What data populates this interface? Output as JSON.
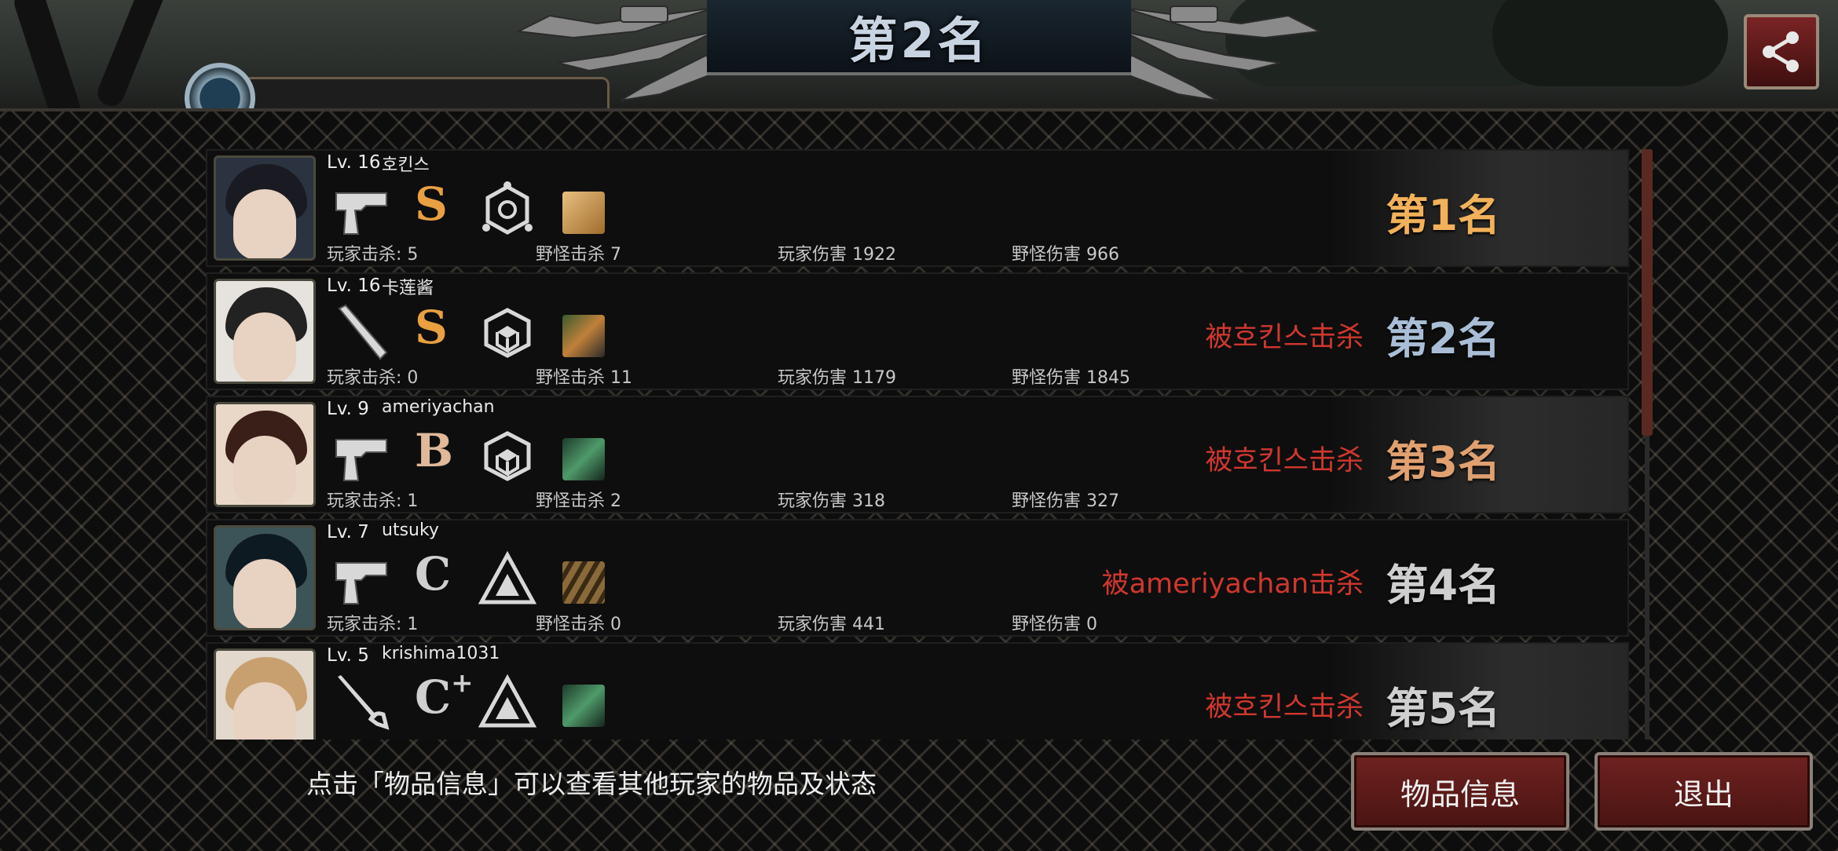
{
  "header": {
    "title": "第2名"
  },
  "footer": {
    "hint": "点击「物品信息」可以查看其他玩家的物品及状态",
    "item_info_label": "物品信息",
    "exit_label": "退出"
  },
  "players": [
    {
      "level": "Lv. 16",
      "name": "호킨스",
      "weapon_icon": "pistol-icon",
      "grade": "S",
      "grade_plus": "",
      "grade_color": "#e9a040",
      "class_icon": "hexagon-emblem-icon",
      "item_icon": "box-item-icon",
      "player_kills": "玩家击杀: 5",
      "monster_kills": "野怪击杀 7",
      "player_damage": "玩家伤害 1922",
      "monster_damage": "野怪伤害 966",
      "killed_by": "",
      "rank": "第1名",
      "rank_color": "#f2b15a"
    },
    {
      "level": "Lv. 16",
      "name": "卡莲酱",
      "weapon_icon": "bat-icon",
      "grade": "S",
      "grade_plus": "",
      "grade_color": "#e9a040",
      "class_icon": "cube-emblem-icon",
      "item_icon": "character-item-icon",
      "player_kills": "玩家击杀: 0",
      "monster_kills": "野怪击杀 11",
      "player_damage": "玩家伤害 1179",
      "monster_damage": "野怪伤害 1845",
      "killed_by": "被호킨스击杀",
      "rank": "第2名",
      "rank_color": "#a9bed6"
    },
    {
      "level": "Lv. 9",
      "name": "ameriyachan",
      "weapon_icon": "pistol-icon",
      "grade": "B",
      "grade_plus": "",
      "grade_color": "#e0b89a",
      "class_icon": "cube-emblem-icon",
      "item_icon": "green-item-icon",
      "player_kills": "玩家击杀: 1",
      "monster_kills": "野怪击杀 2",
      "player_damage": "玩家伤害 318",
      "monster_damage": "野怪伤害 327",
      "killed_by": "被호킨스击杀",
      "rank": "第3名",
      "rank_color": "#e0a070"
    },
    {
      "level": "Lv. 7",
      "name": "utsuky",
      "weapon_icon": "pistol-icon",
      "grade": "C",
      "grade_plus": "",
      "grade_color": "#cfcfcf",
      "class_icon": "triangle-emblem-icon",
      "item_icon": "ammo-item-icon",
      "player_kills": "玩家击杀: 1",
      "monster_kills": "野怪击杀 0",
      "player_damage": "玩家伤害 441",
      "monster_damage": "野怪伤害 0",
      "killed_by": "被ameriyachan击杀",
      "rank": "第4名",
      "rank_color": "#cfcfcf"
    },
    {
      "level": "Lv. 5",
      "name": "krishima1031",
      "weapon_icon": "rapier-icon",
      "grade": "C",
      "grade_plus": "+",
      "grade_color": "#cfcfcf",
      "class_icon": "triangle-emblem-icon",
      "item_icon": "green-item-icon",
      "player_kills": "",
      "monster_kills": "",
      "player_damage": "",
      "monster_damage": "",
      "killed_by": "被호킨스击杀",
      "rank": "第5名",
      "rank_color": "#cfcfcf"
    }
  ]
}
